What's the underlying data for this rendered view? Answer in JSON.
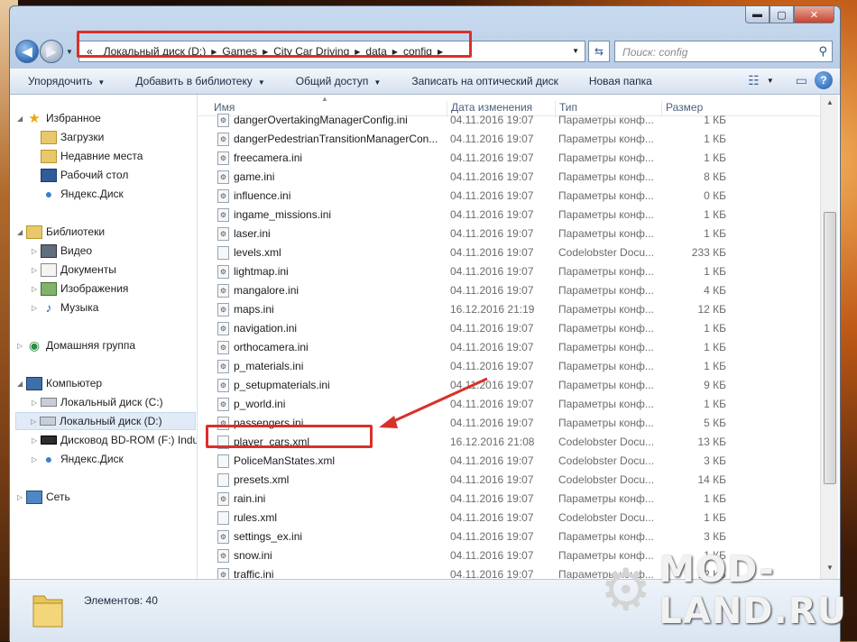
{
  "address_bar": {
    "prefix": "«",
    "crumbs": [
      "Локальный диск (D:)",
      "Games",
      "City Car Driving",
      "data",
      "config"
    ]
  },
  "search": {
    "placeholder": "Поиск: config"
  },
  "toolbar": {
    "organize": "Упорядочить",
    "add_to_library": "Добавить в библиотеку",
    "share": "Общий доступ",
    "burn": "Записать на оптический диск",
    "new_folder": "Новая папка"
  },
  "nav": {
    "favorites": "Избранное",
    "downloads": "Загрузки",
    "recent": "Недавние места",
    "desktop": "Рабочий стол",
    "yandex_disk": "Яндекс.Диск",
    "libraries": "Библиотеки",
    "video": "Видео",
    "documents": "Документы",
    "images": "Изображения",
    "music": "Музыка",
    "homegroup": "Домашняя группа",
    "computer": "Компьютер",
    "drive_c": "Локальный диск (C:)",
    "drive_d": "Локальный диск (D:)",
    "bd_rom": "Дисковод BD-ROM (F:) Indus",
    "yandex_disk2": "Яндекс.Диск",
    "network": "Сеть"
  },
  "columns": {
    "name": "Имя",
    "date": "Дата изменения",
    "type": "Тип",
    "size": "Размер"
  },
  "files": [
    {
      "name": "dangerOvertakingManagerConfig.ini",
      "date": "04.11.2016 19:07",
      "type": "Параметры конф...",
      "size": "1 КБ",
      "kind": "ini"
    },
    {
      "name": "dangerPedestrianTransitionManagerCon...",
      "date": "04.11.2016 19:07",
      "type": "Параметры конф...",
      "size": "1 КБ",
      "kind": "ini"
    },
    {
      "name": "freecamera.ini",
      "date": "04.11.2016 19:07",
      "type": "Параметры конф...",
      "size": "1 КБ",
      "kind": "ini"
    },
    {
      "name": "game.ini",
      "date": "04.11.2016 19:07",
      "type": "Параметры конф...",
      "size": "8 КБ",
      "kind": "ini"
    },
    {
      "name": "influence.ini",
      "date": "04.11.2016 19:07",
      "type": "Параметры конф...",
      "size": "0 КБ",
      "kind": "ini"
    },
    {
      "name": "ingame_missions.ini",
      "date": "04.11.2016 19:07",
      "type": "Параметры конф...",
      "size": "1 КБ",
      "kind": "ini"
    },
    {
      "name": "laser.ini",
      "date": "04.11.2016 19:07",
      "type": "Параметры конф...",
      "size": "1 КБ",
      "kind": "ini"
    },
    {
      "name": "levels.xml",
      "date": "04.11.2016 19:07",
      "type": "Codelobster Docu...",
      "size": "233 КБ",
      "kind": "xml"
    },
    {
      "name": "lightmap.ini",
      "date": "04.11.2016 19:07",
      "type": "Параметры конф...",
      "size": "1 КБ",
      "kind": "ini"
    },
    {
      "name": "mangalore.ini",
      "date": "04.11.2016 19:07",
      "type": "Параметры конф...",
      "size": "4 КБ",
      "kind": "ini"
    },
    {
      "name": "maps.ini",
      "date": "16.12.2016 21:19",
      "type": "Параметры конф...",
      "size": "12 КБ",
      "kind": "ini"
    },
    {
      "name": "navigation.ini",
      "date": "04.11.2016 19:07",
      "type": "Параметры конф...",
      "size": "1 КБ",
      "kind": "ini"
    },
    {
      "name": "orthocamera.ini",
      "date": "04.11.2016 19:07",
      "type": "Параметры конф...",
      "size": "1 КБ",
      "kind": "ini"
    },
    {
      "name": "p_materials.ini",
      "date": "04.11.2016 19:07",
      "type": "Параметры конф...",
      "size": "1 КБ",
      "kind": "ini"
    },
    {
      "name": "p_setupmaterials.ini",
      "date": "04.11.2016 19:07",
      "type": "Параметры конф...",
      "size": "9 КБ",
      "kind": "ini"
    },
    {
      "name": "p_world.ini",
      "date": "04.11.2016 19:07",
      "type": "Параметры конф...",
      "size": "1 КБ",
      "kind": "ini"
    },
    {
      "name": "passengers.ini",
      "date": "04.11.2016 19:07",
      "type": "Параметры конф...",
      "size": "5 КБ",
      "kind": "ini"
    },
    {
      "name": "player_cars.xml",
      "date": "16.12.2016 21:08",
      "type": "Codelobster Docu...",
      "size": "13 КБ",
      "kind": "xml"
    },
    {
      "name": "PoliceManStates.xml",
      "date": "04.11.2016 19:07",
      "type": "Codelobster Docu...",
      "size": "3 КБ",
      "kind": "xml"
    },
    {
      "name": "presets.xml",
      "date": "04.11.2016 19:07",
      "type": "Codelobster Docu...",
      "size": "14 КБ",
      "kind": "xml"
    },
    {
      "name": "rain.ini",
      "date": "04.11.2016 19:07",
      "type": "Параметры конф...",
      "size": "1 КБ",
      "kind": "ini"
    },
    {
      "name": "rules.xml",
      "date": "04.11.2016 19:07",
      "type": "Codelobster Docu...",
      "size": "1 КБ",
      "kind": "xml"
    },
    {
      "name": "settings_ex.ini",
      "date": "04.11.2016 19:07",
      "type": "Параметры конф...",
      "size": "3 КБ",
      "kind": "ini"
    },
    {
      "name": "snow.ini",
      "date": "04.11.2016 19:07",
      "type": "Параметры конф...",
      "size": "1 КБ",
      "kind": "ini"
    },
    {
      "name": "traffic.ini",
      "date": "04.11.2016 19:07",
      "type": "Параметры конф...",
      "size": "12 КБ",
      "kind": "ini"
    }
  ],
  "status": {
    "count": "Элементов: 40"
  },
  "watermark": {
    "text": "MOD-LAND.RU"
  },
  "colors": {
    "highlight": "#d9302a",
    "selection": "#e1ebf7"
  }
}
